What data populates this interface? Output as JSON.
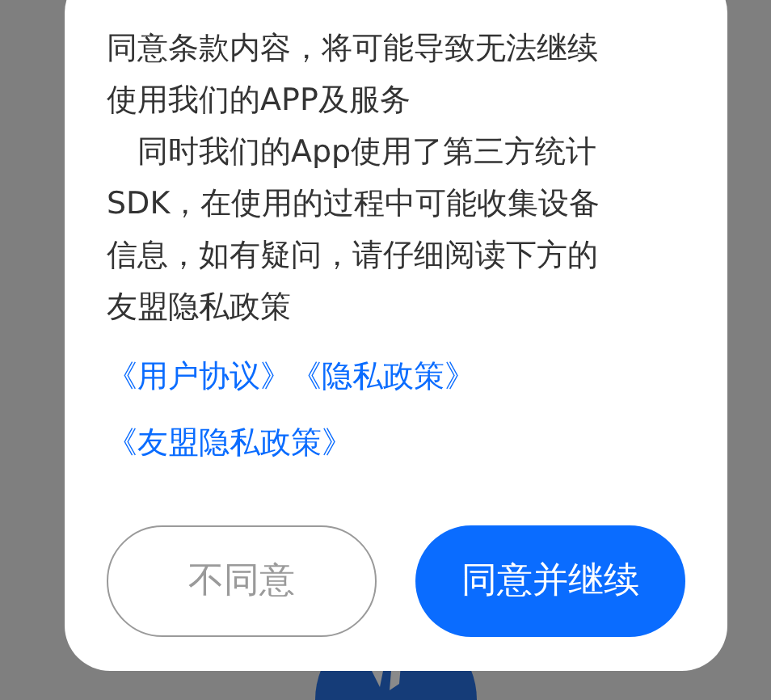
{
  "dialog": {
    "paragraphs": [
      {
        "indent": false,
        "lines": [
          "同意条款内容，将可能导致无法继续",
          "使用我们的APP及服务"
        ]
      },
      {
        "indent": true,
        "lines": [
          "同时我们的App使用了第三方统计",
          "SDK，在使用的过程中可能收集设备",
          "信息，如有疑问，请仔细阅读下方的",
          "友盟隐私政策"
        ]
      }
    ],
    "link_rows": [
      [
        "《用户协议》",
        "《隐私政策》"
      ],
      [
        "《友盟隐私政策》"
      ]
    ],
    "buttons": [
      {
        "label": "不同意",
        "kind": "secondary"
      },
      {
        "label": "同意并继续",
        "kind": "primary"
      }
    ]
  }
}
